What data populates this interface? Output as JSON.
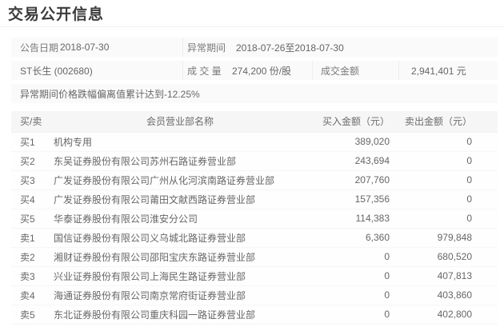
{
  "page": {
    "title": "交易公开信息"
  },
  "info": {
    "announce_date_label": "公告日期",
    "announce_date": "2018-07-30",
    "period_label": "异常期间",
    "period": "2018-07-26至2018-07-30",
    "stock": "ST长生 (002680)",
    "volume_label": "成 交 量",
    "volume": "274,200 份/股",
    "turnover_label": "成交金额",
    "turnover": "2,941,401 元",
    "note": "异常期间价格跌幅偏离值累计达到-12.25%"
  },
  "table": {
    "headers": [
      "买/卖",
      "会员营业部名称",
      "买入金额（元）",
      "卖出金额（元）"
    ],
    "rows": [
      {
        "side": "买1",
        "name": "机构专用",
        "buy": "389,020",
        "sell": "0"
      },
      {
        "side": "买2",
        "name": "东吴证券股份有限公司苏州石路证券营业部",
        "buy": "243,694",
        "sell": "0"
      },
      {
        "side": "买3",
        "name": "广发证券股份有限公司广州从化河滨南路证券营业部",
        "buy": "207,760",
        "sell": "0"
      },
      {
        "side": "买4",
        "name": "广发证券股份有限公司莆田文献西路证券营业部",
        "buy": "157,356",
        "sell": "0"
      },
      {
        "side": "买5",
        "name": "华泰证券股份有限公司淮安分公司",
        "buy": "114,383",
        "sell": "0"
      },
      {
        "side": "卖1",
        "name": "国信证券股份有限公司义乌城北路证券营业部",
        "buy": "6,360",
        "sell": "979,848"
      },
      {
        "side": "卖2",
        "name": "湘财证券股份有限公司邵阳宝庆东路证券营业部",
        "buy": "0",
        "sell": "680,520"
      },
      {
        "side": "卖3",
        "name": "兴业证券股份有限公司上海民生路证券营业部",
        "buy": "0",
        "sell": "407,813"
      },
      {
        "side": "卖4",
        "name": "海通证券股份有限公司南京常府街证券营业部",
        "buy": "0",
        "sell": "403,860"
      },
      {
        "side": "卖5",
        "name": "东北证券股份有限公司重庆科园一路证券营业部",
        "buy": "0",
        "sell": "402,800"
      }
    ]
  },
  "colors": {
    "title_text": "#3c3c3c",
    "body_text": "#666666",
    "row_background": "#fafafa",
    "header_background": "#f6f6f6",
    "divider": "#f1f1f1"
  }
}
